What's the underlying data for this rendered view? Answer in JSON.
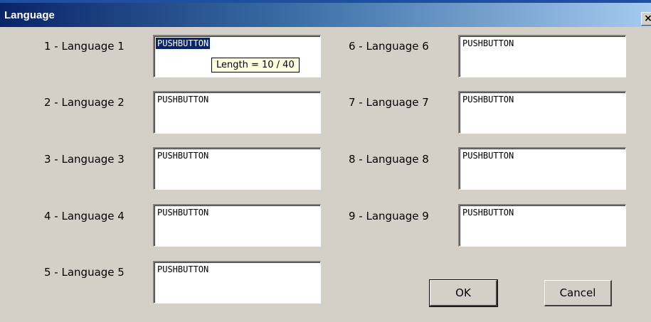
{
  "window": {
    "title": "Language",
    "close_glyph": "×",
    "close_icon": "close-icon"
  },
  "languages": [
    {
      "label": "1 - Language 1",
      "value": "PUSHBUTTON"
    },
    {
      "label": "2 - Language 2",
      "value": "PUSHBUTTON"
    },
    {
      "label": "3 - Language 3",
      "value": "PUSHBUTTON"
    },
    {
      "label": "4 - Language 4",
      "value": "PUSHBUTTON"
    },
    {
      "label": "5 - Language 5",
      "value": "PUSHBUTTON"
    },
    {
      "label": "6 - Language 6",
      "value": "PUSHBUTTON"
    },
    {
      "label": "7 - Language 7",
      "value": "PUSHBUTTON"
    },
    {
      "label": "8 - Language 8",
      "value": "PUSHBUTTON"
    },
    {
      "label": "9 - Language 9",
      "value": "PUSHBUTTON"
    }
  ],
  "tooltip": {
    "text": "Length = 10 / 40"
  },
  "buttons": {
    "ok": "OK",
    "cancel": "Cancel"
  }
}
